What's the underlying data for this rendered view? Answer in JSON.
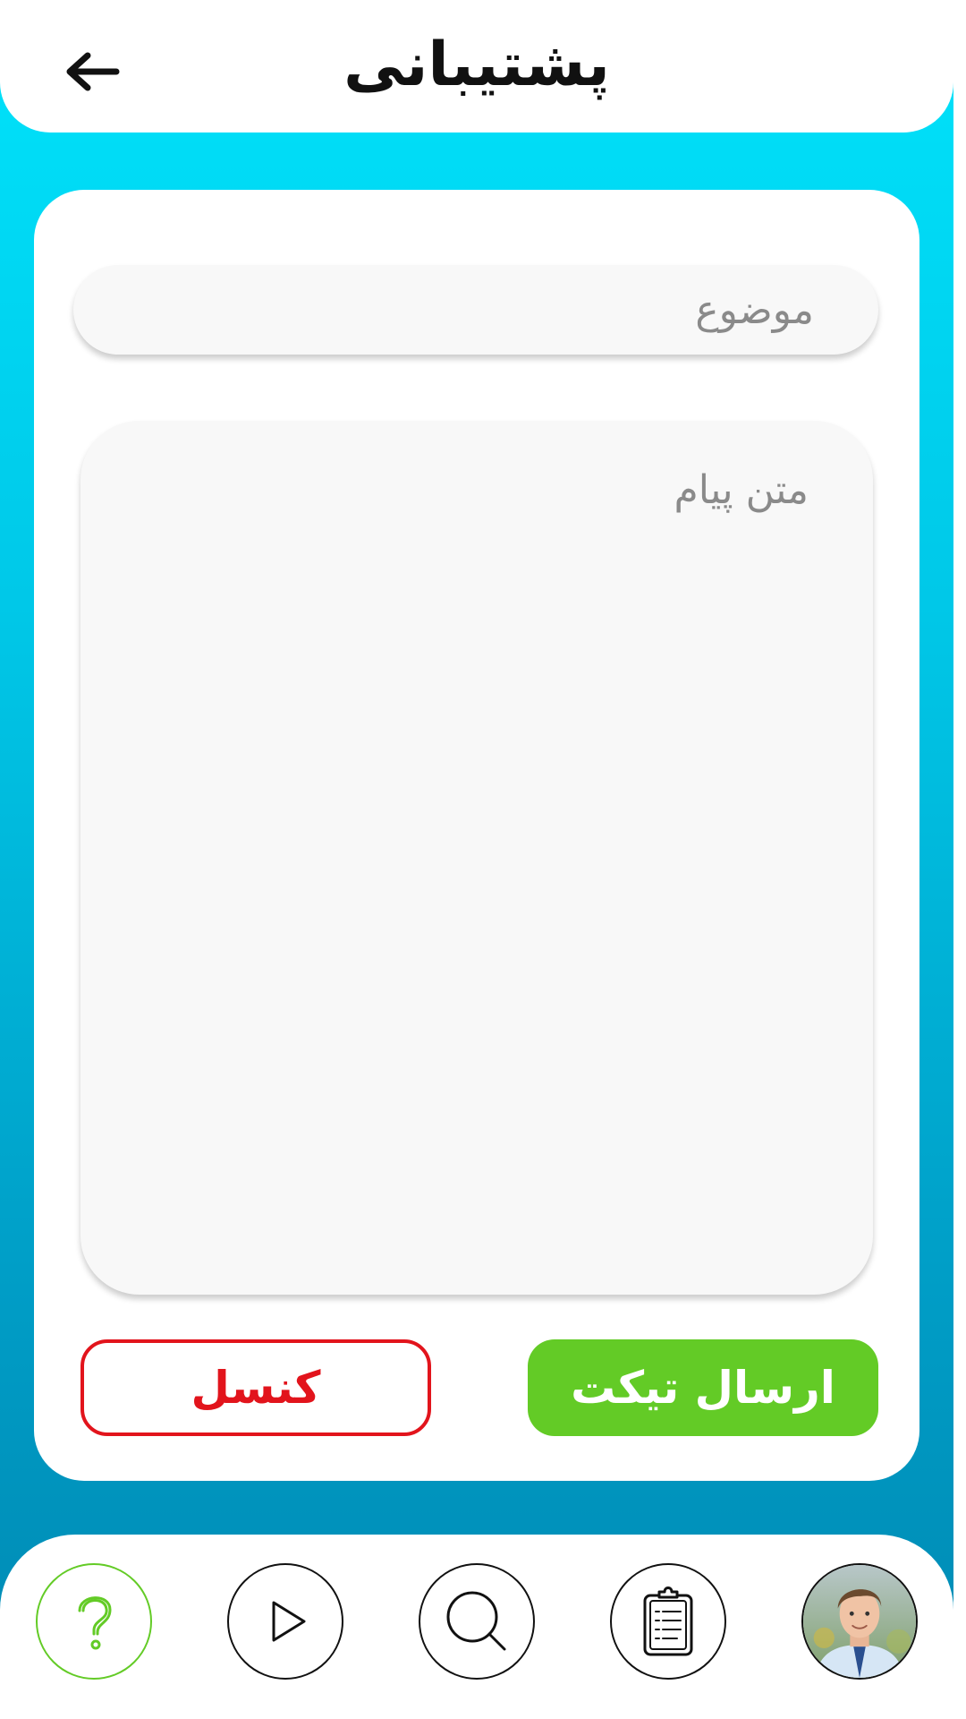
{
  "header": {
    "title": "پشتیبانی",
    "back_icon": "arrow-left-icon"
  },
  "form": {
    "subject_placeholder": "موضوع",
    "message_placeholder": "متن پیام"
  },
  "buttons": {
    "submit_label": "ارسال تیکت",
    "cancel_label": "کنسل"
  },
  "bottom_nav": {
    "items": [
      {
        "icon": "help-icon",
        "active": true
      },
      {
        "icon": "play-icon"
      },
      {
        "icon": "search-icon"
      },
      {
        "icon": "clipboard-icon"
      },
      {
        "icon": "profile-avatar"
      }
    ]
  },
  "colors": {
    "accent_green": "#63cb26",
    "cancel_red": "#e2141c",
    "gradient_top": "#00e3fb",
    "gradient_bottom": "#0089b3"
  }
}
